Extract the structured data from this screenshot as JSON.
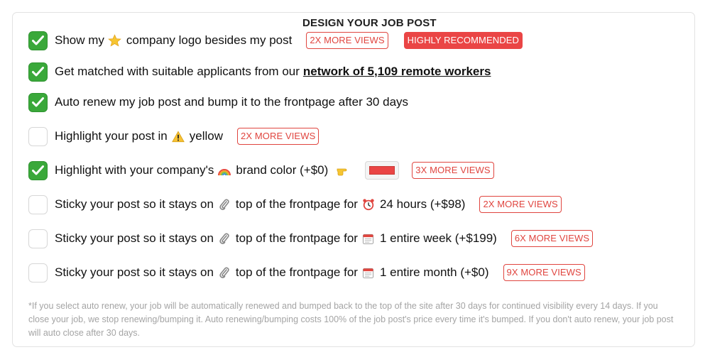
{
  "title": "DESIGN YOUR JOB POST",
  "accent_color": "#ea4545",
  "check_color": "#3aa83a",
  "options": [
    {
      "checked": true,
      "text_before": "Show my",
      "emoji": "star-icon",
      "text_after": "company logo besides my post",
      "badges": [
        "2X MORE VIEWS",
        "HIGHLY RECOMMENDED"
      ]
    },
    {
      "checked": true,
      "text_before": "Get matched with suitable applicants from our",
      "link": "network of 5,109 remote workers"
    },
    {
      "checked": true,
      "text_before": "Auto renew my job post and bump it to the frontpage after 30 days"
    },
    {
      "checked": false,
      "text_before": "Highlight your post in",
      "emoji": "warning-icon",
      "text_after": "yellow",
      "badge": "2X MORE VIEWS"
    },
    {
      "checked": true,
      "text_before": "Highlight with your company's",
      "emoji": "rainbow-icon",
      "text_after": "brand color (+$0)",
      "pointer_emoji": "pointing-hand-icon",
      "brand_color": "#ea4545",
      "badge": "3X MORE VIEWS"
    },
    {
      "checked": false,
      "text_before": "Sticky your post so it stays on",
      "emoji": "paperclip-icon",
      "text_middle": "top of the frontpage for",
      "emoji2": "alarm-clock-icon",
      "text_after": "24 hours (+$98)",
      "badge": "2X MORE VIEWS"
    },
    {
      "checked": false,
      "text_before": "Sticky your post so it stays on",
      "emoji": "paperclip-icon",
      "text_middle": "top of the frontpage for",
      "emoji2": "calendar-icon",
      "text_after": "1 entire week (+$199)",
      "badge": "6X MORE VIEWS"
    },
    {
      "checked": false,
      "text_before": "Sticky your post so it stays on",
      "emoji": "paperclip-icon",
      "text_middle": "top of the frontpage for",
      "emoji2": "calendar-icon",
      "text_after": "1 entire month (+$0)",
      "badge": "9X MORE VIEWS"
    }
  ],
  "footnote": "*If you select auto renew, your job will be automatically renewed and bumped back to the top of the site after 30 days for continued visibility every 14 days. If you close your job, we stop renewing/bumping it. Auto renewing/bumping costs 100% of the job post's price every time it's bumped. If you don't auto renew, your job post will auto close after 30 days."
}
